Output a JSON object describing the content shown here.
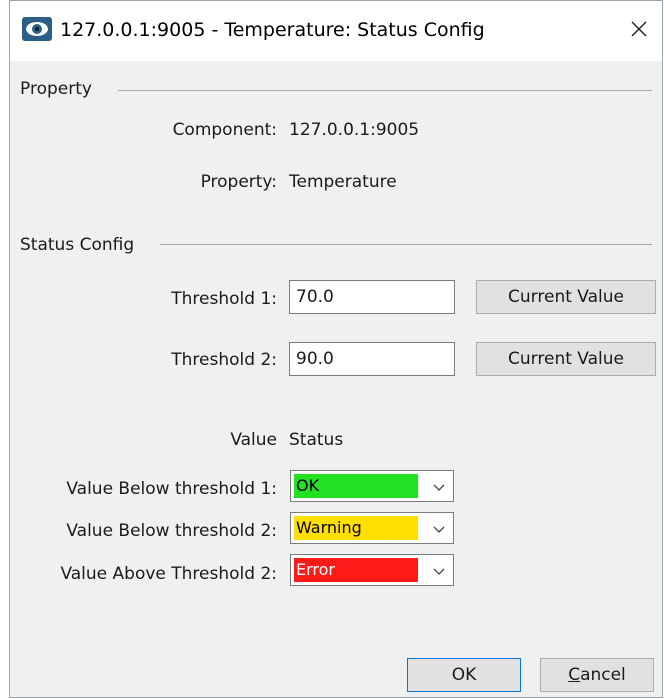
{
  "window": {
    "title": "127.0.0.1:9005 - Temperature: Status Config"
  },
  "property_section": {
    "header": "Property",
    "component_label": "Component:",
    "component_value": "127.0.0.1:9005",
    "property_label": "Property:",
    "property_value": "Temperature"
  },
  "status_section": {
    "header": "Status Config",
    "threshold1_label": "Threshold 1:",
    "threshold1_value": "70.0",
    "threshold2_label": "Threshold 2:",
    "threshold2_value": "90.0",
    "current_value_label": "Current Value"
  },
  "status_table": {
    "value_header": "Value",
    "status_header": "Status",
    "rows": [
      {
        "label": "Value Below threshold 1:",
        "status": "OK",
        "color": "#22e022",
        "text_color": "#000000"
      },
      {
        "label": "Value Below threshold 2:",
        "status": "Warning",
        "color": "#ffe000",
        "text_color": "#000000"
      },
      {
        "label": "Value Above Threshold 2:",
        "status": "Error",
        "color": "#ff1a1a",
        "text_color": "#ffffff"
      }
    ]
  },
  "buttons": {
    "ok": "OK",
    "cancel_first": "C",
    "cancel_rest": "ancel"
  },
  "icons": {
    "app": "eye-icon",
    "close": "close-icon",
    "dropdown": "chevron-down-icon"
  }
}
